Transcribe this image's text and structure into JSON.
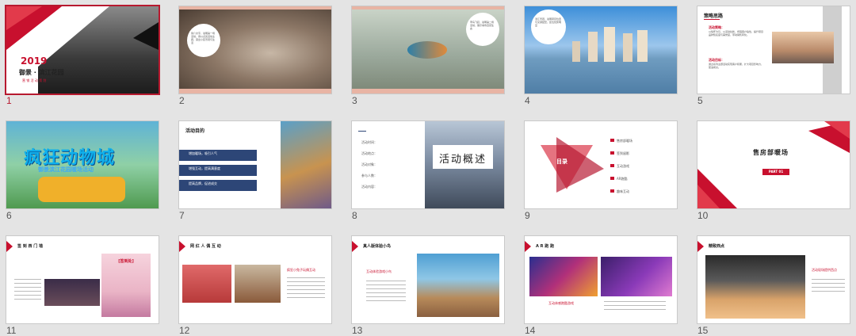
{
  "slides": [
    {
      "number": "1",
      "year": "2019",
      "title": "御景 · 滨江花园",
      "subtitle": "营 销 活 动 策 划"
    },
    {
      "number": "2",
      "bubble": "简介文字，说明第一场活动，用以点亮活动主题，突出小区景观与生活"
    },
    {
      "number": "3",
      "bubble": "翠鸟飞跃，说明第二场活动，展示城市自然生态"
    },
    {
      "number": "4",
      "bubble": "滨江景观，说明项目位置与交通配套，区位优势明显"
    },
    {
      "number": "5",
      "title": "策略思路",
      "h1": "活动策略：",
      "b1": "以情怀为引，以活动拉新，增强客户粘性，提升项目品牌知名度与美誉度，带动销售转化。",
      "h2": "活动目标：",
      "b2": "通过系列主题活动实现客户积累，扩大项目影响力，促进成交。"
    },
    {
      "number": "6",
      "title": "疯狂动物城",
      "subtitle": "御景滨江花园暖场活动"
    },
    {
      "number": "7",
      "title": "活动目的",
      "items": [
        "增加暖场，吸引人气",
        "增强互动，提高满意度",
        "提高品牌，促进成交"
      ]
    },
    {
      "number": "8",
      "heading": "活动概述",
      "rows": [
        "活动时间：",
        "活动地点：",
        "活动对象：",
        "参与人数：",
        "活动内容："
      ]
    },
    {
      "number": "9",
      "center": "目录",
      "items": [
        "售房部暖场",
        "签到留影",
        "互动游戏",
        "AR跑酷",
        "趣味互动"
      ]
    },
    {
      "number": "10",
      "title": "售房部暖场",
      "part": "PART 01"
    },
    {
      "number": "11",
      "title": "签 到 西 门 墙",
      "sign": "[签到处]"
    },
    {
      "number": "12",
      "title": "网 红 人 偶 互 动",
      "caption": "疯狂小兔子玩偶互动"
    },
    {
      "number": "13",
      "title": "真人版体验小鸟",
      "caption": "互动体验游戏小鸟"
    },
    {
      "number": "14",
      "title": "A R 跑 跑",
      "caption": "互动体感跑酷游戏"
    },
    {
      "number": "15",
      "title": "精致西点",
      "caption": "活动现场提供西点"
    }
  ],
  "colors": {
    "accent": "#c8102e",
    "selection": "#b7192f",
    "navy": "#2d4677"
  }
}
